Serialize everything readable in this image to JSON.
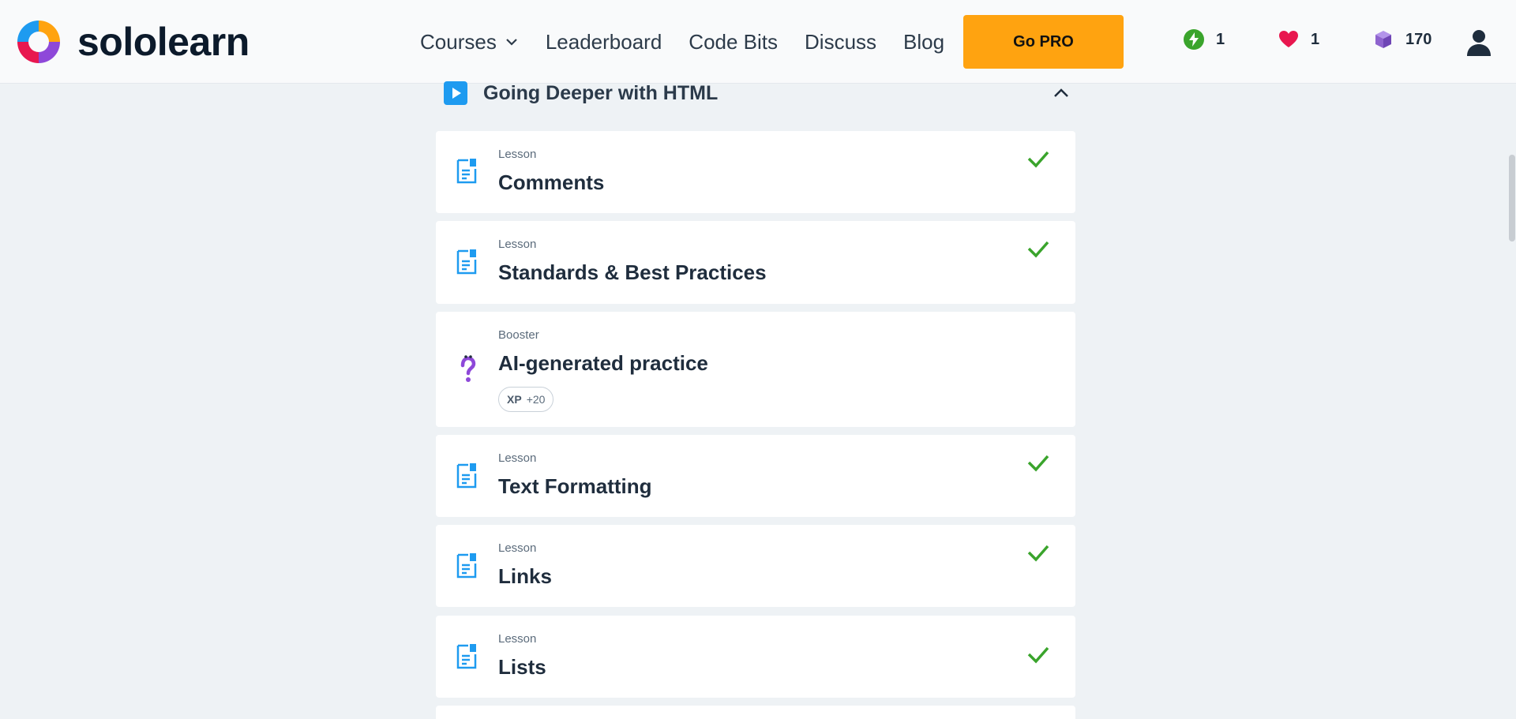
{
  "brand": {
    "name": "sololearn"
  },
  "nav": {
    "courses": "Courses",
    "leaderboard": "Leaderboard",
    "code_bits": "Code Bits",
    "discuss": "Discuss",
    "blog": "Blog"
  },
  "header": {
    "go_pro": "Go PRO",
    "streak": "1",
    "hearts": "1",
    "gems": "170"
  },
  "section": {
    "title": "Going Deeper with HTML"
  },
  "cards": [
    {
      "kind": "Lesson",
      "title": "Comments",
      "completed": true,
      "icon": "lesson-doc-icon"
    },
    {
      "kind": "Lesson",
      "title": "Standards & Best Practices",
      "completed": true,
      "icon": "lesson-doc-icon"
    },
    {
      "kind": "Booster",
      "title": "AI-generated practice",
      "completed": false,
      "icon": "question-mark-icon",
      "xp_label": "XP",
      "xp_value": "+20"
    },
    {
      "kind": "Lesson",
      "title": "Text Formatting",
      "completed": true,
      "icon": "lesson-doc-icon"
    },
    {
      "kind": "Lesson",
      "title": "Links",
      "completed": true,
      "icon": "lesson-doc-icon"
    },
    {
      "kind": "Lesson",
      "title": "Lists",
      "completed": true,
      "icon": "lesson-doc-icon"
    }
  ],
  "colors": {
    "accent_pro": "#ffa310",
    "lesson_icon": "#1e9bf0",
    "check": "#3aa42c",
    "heart": "#e8174f",
    "gem": "#8e63ce",
    "streak": "#3aa42c"
  }
}
